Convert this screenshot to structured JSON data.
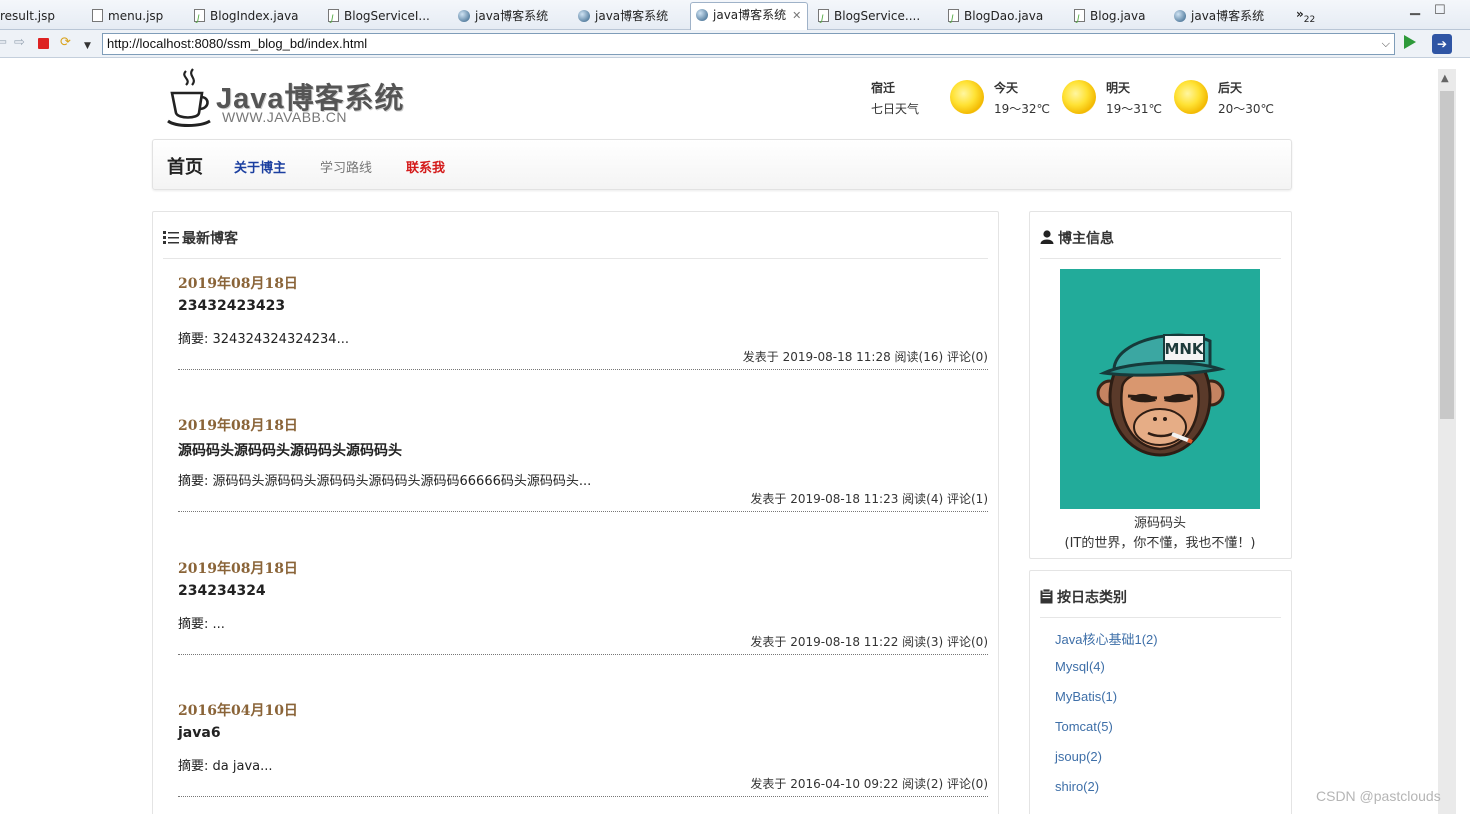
{
  "editor_tabs": [
    {
      "label": "result.jsp",
      "icon": "file-icon"
    },
    {
      "label": "menu.jsp",
      "icon": "file-icon"
    },
    {
      "label": "BlogIndex.java",
      "icon": "java-file-icon"
    },
    {
      "label": "BlogServiceI...",
      "icon": "java-file-icon"
    },
    {
      "label": "java博客系统",
      "icon": "globe-icon"
    },
    {
      "label": "java博客系统",
      "icon": "globe-icon"
    },
    {
      "label": "java博客系统",
      "icon": "globe-icon",
      "active": true
    },
    {
      "label": "BlogService....",
      "icon": "java-file-icon"
    },
    {
      "label": "BlogDao.java",
      "icon": "java-file-icon"
    },
    {
      "label": "Blog.java",
      "icon": "java-file-icon"
    },
    {
      "label": "java博客系统",
      "icon": "globe-icon"
    }
  ],
  "overflow_tabs": {
    "chevron": "»",
    "count": "22"
  },
  "toolbar": {
    "url": "http://localhost:8080/ssm_blog_bd/index.html"
  },
  "site": {
    "logo_title": "Java博客系统",
    "logo_subtitle": "WWW.JAVABB.CN"
  },
  "weather": {
    "city": "宿迁",
    "label": "七日天气",
    "days": [
      {
        "name": "今天",
        "temp": "19～32℃",
        "icon": "sun-icon"
      },
      {
        "name": "明天",
        "temp": "19～31℃",
        "icon": "sun-icon"
      },
      {
        "name": "后天",
        "temp": "20～30℃",
        "icon": "sun-icon"
      }
    ]
  },
  "nav": {
    "home": "首页",
    "about": "关于博主",
    "roadmap": "学习路线",
    "contact": "联系我"
  },
  "latest": {
    "heading": "最新博客",
    "posts": [
      {
        "date": "2019年08月18日",
        "title": "23432423423",
        "summary": "摘要: 324324324324234...",
        "meta": "发表于 2019-08-18 11:28 阅读(16) 评论(0)"
      },
      {
        "date": "2019年08月18日",
        "title": "源码码头源码码头源码码头源码码头",
        "summary": "摘要: 源码码头源码码头源码码头源码码头源码码66666码头源码码头...",
        "meta": "发表于 2019-08-18 11:23 阅读(4) 评论(1)"
      },
      {
        "date": "2019年08月18日",
        "title": "234234324",
        "summary": "摘要: ...",
        "meta": "发表于 2019-08-18 11:22 阅读(3) 评论(0)"
      },
      {
        "date": "2016年04月10日",
        "title": "java6",
        "summary": "摘要: da java...",
        "meta": "发表于 2016-04-10 09:22 阅读(2) 评论(0)"
      }
    ]
  },
  "author": {
    "heading": "博主信息",
    "name": "源码码头",
    "motto": "(IT的世界，你不懂，我也不懂！)",
    "cap_text": "MNK"
  },
  "categories": {
    "heading": "按日志类别",
    "items": [
      "Java核心基础1(2)",
      "Mysql(4)",
      "MyBatis(1)",
      "Tomcat(5)",
      "jsoup(2)",
      "shiro(2)"
    ]
  },
  "watermark": "CSDN @pastclouds",
  "colors": {
    "date_brown": "#8a6438",
    "nav_link_blue": "#1b3fa0",
    "nav_contact_red": "#d41b1b",
    "category_link": "#3e6fa8",
    "avatar_bg": "#22ab9a"
  }
}
